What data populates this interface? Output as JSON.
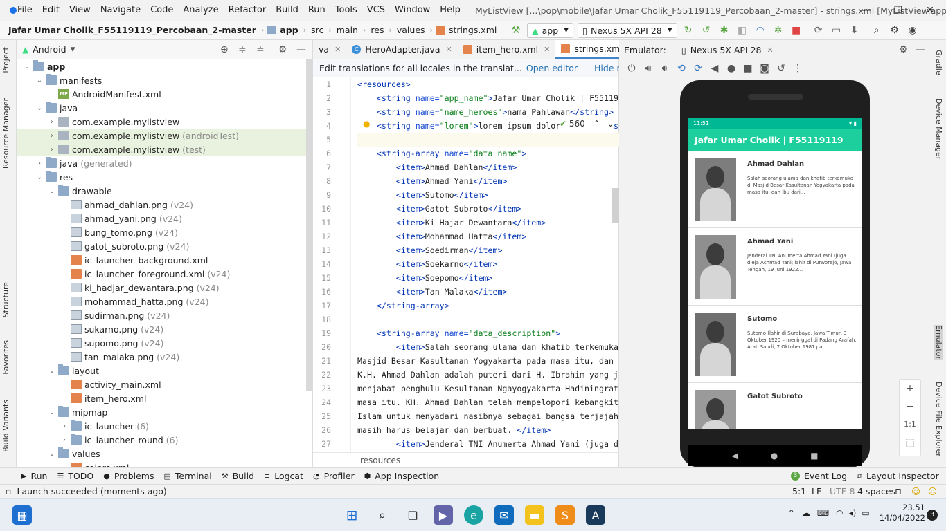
{
  "menu": [
    "File",
    "Edit",
    "View",
    "Navigate",
    "Code",
    "Analyze",
    "Refactor",
    "Build",
    "Run",
    "Tools",
    "VCS",
    "Window",
    "Help"
  ],
  "window_title": "MyListView [...\\pop\\mobile\\Jafar Umar Cholik_F55119119_Percobaan_2-master] - strings.xml [MyListView.app]",
  "breadcrumb": [
    "Jafar Umar Cholik_F55119119_Percobaan_2-master",
    "app",
    "src",
    "main",
    "res",
    "values",
    "strings.xml"
  ],
  "toolbar": {
    "run_config": "app",
    "device": "Nexus 5X API 28"
  },
  "left_tabs": [
    "Project",
    "Resource Manager",
    "Structure",
    "Favorites",
    "Build Variants"
  ],
  "right_tabs": [
    "Gradle",
    "Device Manager",
    "Emulator",
    "Device File Explorer"
  ],
  "project": {
    "view_label": "Android",
    "tree": [
      {
        "label": "app",
        "suffix": "",
        "depth": 0,
        "arrow": "open",
        "icon": "folder",
        "bold": true
      },
      {
        "label": "manifests",
        "suffix": "",
        "depth": 1,
        "arrow": "open",
        "icon": "folder"
      },
      {
        "label": "AndroidManifest.xml",
        "suffix": "",
        "depth": 2,
        "arrow": "",
        "icon": "mf"
      },
      {
        "label": "java",
        "suffix": "",
        "depth": 1,
        "arrow": "open",
        "icon": "folder"
      },
      {
        "label": "com.example.mylistview",
        "suffix": "",
        "depth": 2,
        "arrow": "closed",
        "icon": "pkg"
      },
      {
        "label": "com.example.mylistview",
        "suffix": "(androidTest)",
        "depth": 2,
        "arrow": "closed",
        "icon": "pkg",
        "selected": true
      },
      {
        "label": "com.example.mylistview",
        "suffix": "(test)",
        "depth": 2,
        "arrow": "closed",
        "icon": "pkg",
        "selected": true
      },
      {
        "label": "java",
        "suffix": "(generated)",
        "depth": 1,
        "arrow": "closed",
        "icon": "folder"
      },
      {
        "label": "res",
        "suffix": "",
        "depth": 1,
        "arrow": "open",
        "icon": "folder"
      },
      {
        "label": "drawable",
        "suffix": "",
        "depth": 2,
        "arrow": "open",
        "icon": "folder"
      },
      {
        "label": "ahmad_dahlan.png",
        "suffix": "(v24)",
        "depth": 3,
        "arrow": "",
        "icon": "png"
      },
      {
        "label": "ahmad_yani.png",
        "suffix": "(v24)",
        "depth": 3,
        "arrow": "",
        "icon": "png"
      },
      {
        "label": "bung_tomo.png",
        "suffix": "(v24)",
        "depth": 3,
        "arrow": "",
        "icon": "png"
      },
      {
        "label": "gatot_subroto.png",
        "suffix": "(v24)",
        "depth": 3,
        "arrow": "",
        "icon": "png"
      },
      {
        "label": "ic_launcher_background.xml",
        "suffix": "",
        "depth": 3,
        "arrow": "",
        "icon": "xml"
      },
      {
        "label": "ic_launcher_foreground.xml",
        "suffix": "(v24)",
        "depth": 3,
        "arrow": "",
        "icon": "xml"
      },
      {
        "label": "ki_hadjar_dewantara.png",
        "suffix": "(v24)",
        "depth": 3,
        "arrow": "",
        "icon": "png"
      },
      {
        "label": "mohammad_hatta.png",
        "suffix": "(v24)",
        "depth": 3,
        "arrow": "",
        "icon": "png"
      },
      {
        "label": "sudirman.png",
        "suffix": "(v24)",
        "depth": 3,
        "arrow": "",
        "icon": "png"
      },
      {
        "label": "sukarno.png",
        "suffix": "(v24)",
        "depth": 3,
        "arrow": "",
        "icon": "png"
      },
      {
        "label": "supomo.png",
        "suffix": "(v24)",
        "depth": 3,
        "arrow": "",
        "icon": "png"
      },
      {
        "label": "tan_malaka.png",
        "suffix": "(v24)",
        "depth": 3,
        "arrow": "",
        "icon": "png"
      },
      {
        "label": "layout",
        "suffix": "",
        "depth": 2,
        "arrow": "open",
        "icon": "folder"
      },
      {
        "label": "activity_main.xml",
        "suffix": "",
        "depth": 3,
        "arrow": "",
        "icon": "xml"
      },
      {
        "label": "item_hero.xml",
        "suffix": "",
        "depth": 3,
        "arrow": "",
        "icon": "xml"
      },
      {
        "label": "mipmap",
        "suffix": "",
        "depth": 2,
        "arrow": "open",
        "icon": "folder"
      },
      {
        "label": "ic_launcher",
        "suffix": "(6)",
        "depth": 3,
        "arrow": "closed",
        "icon": "folder"
      },
      {
        "label": "ic_launcher_round",
        "suffix": "(6)",
        "depth": 3,
        "arrow": "closed",
        "icon": "folder"
      },
      {
        "label": "values",
        "suffix": "",
        "depth": 2,
        "arrow": "open",
        "icon": "folder"
      },
      {
        "label": "colors.xml",
        "suffix": "",
        "depth": 3,
        "arrow": "",
        "icon": "xml"
      }
    ]
  },
  "editor": {
    "tabs": [
      {
        "label": "va",
        "active": false
      },
      {
        "label": "HeroAdapter.java",
        "active": false
      },
      {
        "label": "item_hero.xml",
        "active": false
      },
      {
        "label": "strings.xml",
        "active": true
      }
    ],
    "notice": "Edit translations for all locales in the translat...",
    "open_editor": "Open editor",
    "hide_notification": "Hide notification",
    "inspection_count": "560",
    "breadcrumb": "resources",
    "lines": [
      {
        "n": "1",
        "parts": [
          [
            "tag",
            "<resources>"
          ]
        ]
      },
      {
        "n": "2",
        "parts": [
          [
            "txt",
            "    "
          ],
          [
            "tag",
            "<string "
          ],
          [
            "attr",
            "name="
          ],
          [
            "val",
            "\"app_name\""
          ],
          [
            "tag",
            ">"
          ],
          [
            "txt",
            "Jafar Umar Cholik | F55119"
          ]
        ]
      },
      {
        "n": "3",
        "parts": [
          [
            "txt",
            "    "
          ],
          [
            "tag",
            "<string "
          ],
          [
            "attr",
            "name="
          ],
          [
            "val",
            "\"name_heroes\""
          ],
          [
            "tag",
            ">"
          ],
          [
            "txt",
            "nama Pahlawan"
          ],
          [
            "tag",
            "</string>"
          ]
        ]
      },
      {
        "n": "4",
        "parts": [
          [
            "txt",
            "    "
          ],
          [
            "tag",
            "<string "
          ],
          [
            "attr",
            "name="
          ],
          [
            "val",
            "\"lorem\""
          ],
          [
            "tag",
            ">"
          ],
          [
            "txt",
            "lorem ipsum dolor sit amet"
          ],
          [
            "tag",
            "</s"
          ]
        ]
      },
      {
        "n": "5",
        "parts": [
          [
            "txt",
            ""
          ]
        ],
        "current": true
      },
      {
        "n": "6",
        "parts": [
          [
            "txt",
            "    "
          ],
          [
            "tag",
            "<string-array "
          ],
          [
            "attr",
            "name="
          ],
          [
            "val",
            "\"data_name\""
          ],
          [
            "tag",
            ">"
          ]
        ]
      },
      {
        "n": "7",
        "parts": [
          [
            "txt",
            "        "
          ],
          [
            "tag",
            "<item>"
          ],
          [
            "txt",
            "Ahmad Dahlan"
          ],
          [
            "tag",
            "</item>"
          ]
        ]
      },
      {
        "n": "8",
        "parts": [
          [
            "txt",
            "        "
          ],
          [
            "tag",
            "<item>"
          ],
          [
            "txt",
            "Ahmad Yani"
          ],
          [
            "tag",
            "</item>"
          ]
        ]
      },
      {
        "n": "9",
        "parts": [
          [
            "txt",
            "        "
          ],
          [
            "tag",
            "<item>"
          ],
          [
            "txt",
            "Sutomo"
          ],
          [
            "tag",
            "</item>"
          ]
        ]
      },
      {
        "n": "10",
        "parts": [
          [
            "txt",
            "        "
          ],
          [
            "tag",
            "<item>"
          ],
          [
            "txt",
            "Gatot Subroto"
          ],
          [
            "tag",
            "</item>"
          ]
        ]
      },
      {
        "n": "11",
        "parts": [
          [
            "txt",
            "        "
          ],
          [
            "tag",
            "<item>"
          ],
          [
            "txt",
            "Ki Hajar Dewantara"
          ],
          [
            "tag",
            "</item>"
          ]
        ]
      },
      {
        "n": "12",
        "parts": [
          [
            "txt",
            "        "
          ],
          [
            "tag",
            "<item>"
          ],
          [
            "txt",
            "Mohammad Hatta"
          ],
          [
            "tag",
            "</item>"
          ]
        ]
      },
      {
        "n": "13",
        "parts": [
          [
            "txt",
            "        "
          ],
          [
            "tag",
            "<item>"
          ],
          [
            "txt",
            "Soedirman"
          ],
          [
            "tag",
            "</item>"
          ]
        ]
      },
      {
        "n": "14",
        "parts": [
          [
            "txt",
            "        "
          ],
          [
            "tag",
            "<item>"
          ],
          [
            "txt",
            "Soekarno"
          ],
          [
            "tag",
            "</item>"
          ]
        ]
      },
      {
        "n": "15",
        "parts": [
          [
            "txt",
            "        "
          ],
          [
            "tag",
            "<item>"
          ],
          [
            "txt",
            "Soepomo"
          ],
          [
            "tag",
            "</item>"
          ]
        ]
      },
      {
        "n": "16",
        "parts": [
          [
            "txt",
            "        "
          ],
          [
            "tag",
            "<item>"
          ],
          [
            "txt",
            "Tan Malaka"
          ],
          [
            "tag",
            "</item>"
          ]
        ]
      },
      {
        "n": "17",
        "parts": [
          [
            "txt",
            "    "
          ],
          [
            "tag",
            "</string-array>"
          ]
        ]
      },
      {
        "n": "18",
        "parts": [
          [
            "txt",
            ""
          ]
        ]
      },
      {
        "n": "19",
        "parts": [
          [
            "txt",
            "    "
          ],
          [
            "tag",
            "<string-array "
          ],
          [
            "attr",
            "name="
          ],
          [
            "val",
            "\"data_description\""
          ],
          [
            "tag",
            ">"
          ]
        ]
      },
      {
        "n": "20",
        "parts": [
          [
            "txt",
            "        "
          ],
          [
            "tag",
            "<item>"
          ],
          [
            "txt",
            "Salah seorang ulama dan khatib terkemuka"
          ]
        ]
      },
      {
        "n": "21",
        "parts": [
          [
            "txt",
            "Masjid Besar Kasultanan Yogyakarta pada masa itu, dan"
          ]
        ]
      },
      {
        "n": "22",
        "parts": [
          [
            "txt",
            "K.H. Ahmad Dahlan adalah puteri dari H. Ibrahim yang j"
          ]
        ]
      },
      {
        "n": "23",
        "parts": [
          [
            "txt",
            "menjabat penghulu Kesultanan Ngayogyakarta Hadiningrat"
          ]
        ]
      },
      {
        "n": "24",
        "parts": [
          [
            "txt",
            "masa itu. KH. Ahmad Dahlan telah mempelopori kebangkit"
          ]
        ]
      },
      {
        "n": "25",
        "parts": [
          [
            "txt",
            "Islam untuk menyadari nasibnya sebagai bangsa terjajah"
          ]
        ]
      },
      {
        "n": "26",
        "parts": [
          [
            "txt",
            "masih harus belajar dan berbuat. "
          ],
          [
            "tag",
            "</item>"
          ]
        ]
      },
      {
        "n": "27",
        "parts": [
          [
            "txt",
            "        "
          ],
          [
            "tag",
            "<item>"
          ],
          [
            "txt",
            "Jenderal TNI Anumerta Ahmad Yani (juga d"
          ]
        ]
      }
    ]
  },
  "emulator": {
    "label": "Emulator:",
    "device_tab": "Nexus 5X API 28",
    "status_time": "11:51",
    "app_title": "Jafar Umar Cholik | F55119119",
    "heroes": [
      {
        "name": "Ahmad Dahlan",
        "desc": "Salah seorang ulama dan khatib terkemuka di Masjid Besar Kasultanan Yogyakarta pada masa itu, dan ibu dari..."
      },
      {
        "name": "Ahmad Yani",
        "desc": "Jenderal TNI Anumerta Ahmad Yani (juga dieja Achmad Yani; lahir di Purworejo, Jawa Tengah, 19 Juni 1922..."
      },
      {
        "name": "Sutomo",
        "desc": "Sutomo (lahir di Surabaya, Jawa Timur, 3 Oktober 1920 – meninggal di Padang Arafah, Arab Saudi, 7 Oktober 1981 pa..."
      },
      {
        "name": "Gatot Subroto",
        "desc": ""
      }
    ],
    "zoom": [
      "+",
      "−",
      "1:1",
      "⬚"
    ]
  },
  "tool_windows": [
    {
      "label": "Run",
      "icon": "▶"
    },
    {
      "label": "TODO",
      "icon": "☰"
    },
    {
      "label": "Problems",
      "icon": "●"
    },
    {
      "label": "Terminal",
      "icon": "▤"
    },
    {
      "label": "Build",
      "icon": "⚒"
    },
    {
      "label": "Logcat",
      "icon": "≡"
    },
    {
      "label": "Profiler",
      "icon": "◔"
    },
    {
      "label": "App Inspection",
      "icon": "⬢"
    }
  ],
  "tool_windows_right": [
    {
      "label": "Event Log",
      "icon": "3"
    },
    {
      "label": "Layout Inspector",
      "icon": "⧉"
    }
  ],
  "status": {
    "message": "Launch succeeded (moments ago)",
    "position": "5:1",
    "line_sep": "LF",
    "encoding": "UTF-8",
    "indent": "4 spaces"
  },
  "taskbar": {
    "time": "23.51",
    "date": "14/04/2022",
    "notifications": "3"
  }
}
